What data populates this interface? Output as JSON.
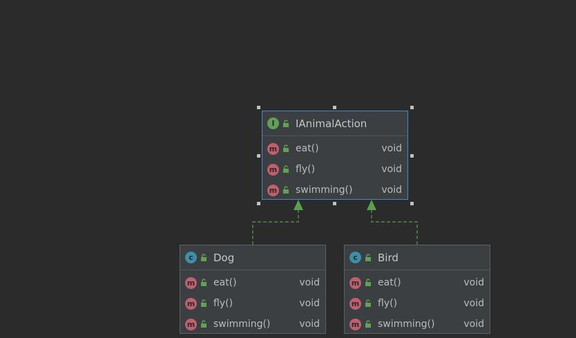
{
  "interface": {
    "kind_letter": "I",
    "name": "IAnimalAction",
    "members": [
      {
        "kind_letter": "m",
        "name": "eat()",
        "type": "void"
      },
      {
        "kind_letter": "m",
        "name": "fly()",
        "type": "void"
      },
      {
        "kind_letter": "m",
        "name": "swimming()",
        "type": "void"
      }
    ]
  },
  "classes": [
    {
      "kind_letter": "c",
      "name": "Dog",
      "members": [
        {
          "kind_letter": "m",
          "name": "eat()",
          "type": "void"
        },
        {
          "kind_letter": "m",
          "name": "fly()",
          "type": "void"
        },
        {
          "kind_letter": "m",
          "name": "swimming()",
          "type": "void"
        }
      ]
    },
    {
      "kind_letter": "c",
      "name": "Bird",
      "members": [
        {
          "kind_letter": "m",
          "name": "eat()",
          "type": "void"
        },
        {
          "kind_letter": "m",
          "name": "fly()",
          "type": "void"
        },
        {
          "kind_letter": "m",
          "name": "swimming()",
          "type": "void"
        }
      ]
    }
  ],
  "colors": {
    "background": "#2b2b2b",
    "node": "#3c3f41",
    "selection": "#4a88c7",
    "inheritance_arrow": "#5a9e4e",
    "interface_icon": "#62a055",
    "class_icon": "#3d8ea8",
    "method_icon": "#c0606e"
  },
  "icons": {
    "interface": "interface-icon",
    "class": "class-icon",
    "method": "method-icon",
    "visibility": "public-lock-icon"
  }
}
